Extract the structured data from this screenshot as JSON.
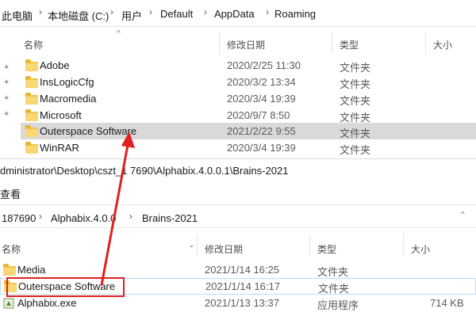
{
  "top_window": {
    "breadcrumb": [
      "此电脑",
      "本地磁盘 (C:)",
      "用户",
      "Default",
      "AppData",
      "Roaming"
    ],
    "headers": {
      "name": "名称",
      "date": "修改日期",
      "type": "类型",
      "size": "大小"
    },
    "rows": [
      {
        "name": "Adobe",
        "date": "2020/2/25 11:30",
        "type": "文件夹"
      },
      {
        "name": "InsLogicCfg",
        "date": "2020/3/2 13:34",
        "type": "文件夹"
      },
      {
        "name": "Macromedia",
        "date": "2020/3/4 19:39",
        "type": "文件夹"
      },
      {
        "name": "Microsoft",
        "date": "2020/9/7 8:50",
        "type": "文件夹"
      },
      {
        "name": "Outerspace Software",
        "date": "2021/2/22 9:55",
        "type": "文件夹"
      },
      {
        "name": "WinRAR",
        "date": "2020/3/4 19:39",
        "type": "文件夹"
      }
    ]
  },
  "bottom_window": {
    "title_path": "dministrator\\Desktop\\cszt_1 7690\\Alphabix.4.0.0.1\\Brains-2021",
    "menu_view": "查看",
    "breadcrumb": [
      "187690",
      "Alphabix.4.0.0",
      "Brains-2021"
    ],
    "headers": {
      "name": "名称",
      "date": "修改日期",
      "type": "类型",
      "size": "大小"
    },
    "rows": [
      {
        "name": "Media",
        "date": "2021/1/14 16:25",
        "type": "文件夹",
        "size": ""
      },
      {
        "name": "Outerspace Software",
        "date": "2021/1/14 16:17",
        "type": "文件夹",
        "size": ""
      },
      {
        "name": "Alphabix.exe",
        "date": "2021/1/13 13:37",
        "type": "应用程序",
        "size": "714 KB"
      }
    ]
  },
  "colors": {
    "annotation": "#e02020",
    "selected_row": "#d9d9d9",
    "folder": "#f3c64a"
  }
}
